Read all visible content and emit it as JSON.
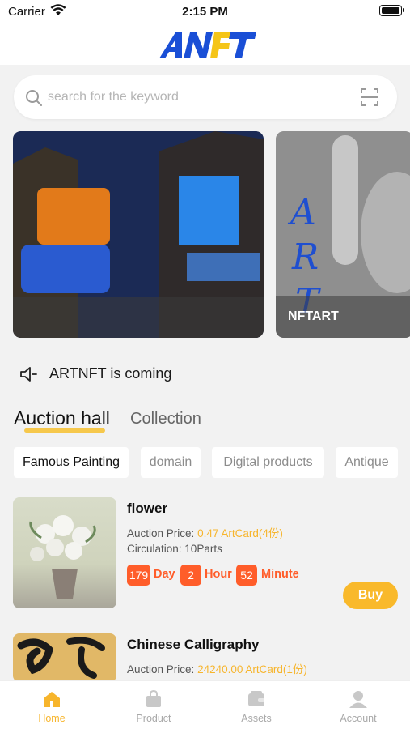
{
  "status_bar": {
    "carrier": "Carrier",
    "time": "2:15 PM"
  },
  "header": {
    "logo_text": "ANFT",
    "brand_color": "#1a4fd6",
    "accent_color": "#f5c518"
  },
  "search": {
    "placeholder": "search for the keyword"
  },
  "banners": [
    {
      "caption": ""
    },
    {
      "caption": "NFTART"
    }
  ],
  "notice": {
    "text": "ARTNFT is coming"
  },
  "main_tabs": [
    {
      "label": "Auction hall",
      "active": true
    },
    {
      "label": "Collection",
      "active": false
    }
  ],
  "categories": [
    {
      "label": "Famous Painting",
      "active": true
    },
    {
      "label": "domain",
      "active": false
    },
    {
      "label": "Digital products",
      "active": false
    },
    {
      "label": "Antique",
      "active": false
    }
  ],
  "items": [
    {
      "title": "flower",
      "price_label": "Auction Price:",
      "price_value": "0.47 ArtCard(4份)",
      "circulation_label": "Circulation:",
      "circulation_value": "10Parts",
      "countdown": {
        "days": "179",
        "days_unit": "Day",
        "hours": "2",
        "hours_unit": "Hour",
        "minutes": "52",
        "minutes_unit": "Minute"
      },
      "buy_label": "Buy"
    },
    {
      "title": "Chinese Calligraphy",
      "price_label": "Auction Price:",
      "price_value": "24240.00 ArtCard(1份)"
    }
  ],
  "tab_bar": [
    {
      "label": "Home",
      "icon": "home-icon",
      "active": true
    },
    {
      "label": "Product",
      "icon": "bag-icon",
      "active": false
    },
    {
      "label": "Assets",
      "icon": "wallet-icon",
      "active": false
    },
    {
      "label": "Account",
      "icon": "person-icon",
      "active": false
    }
  ],
  "colors": {
    "accent": "#f7b52c",
    "countdown": "#ff5d2a",
    "buy_button": "#f9b92b"
  }
}
